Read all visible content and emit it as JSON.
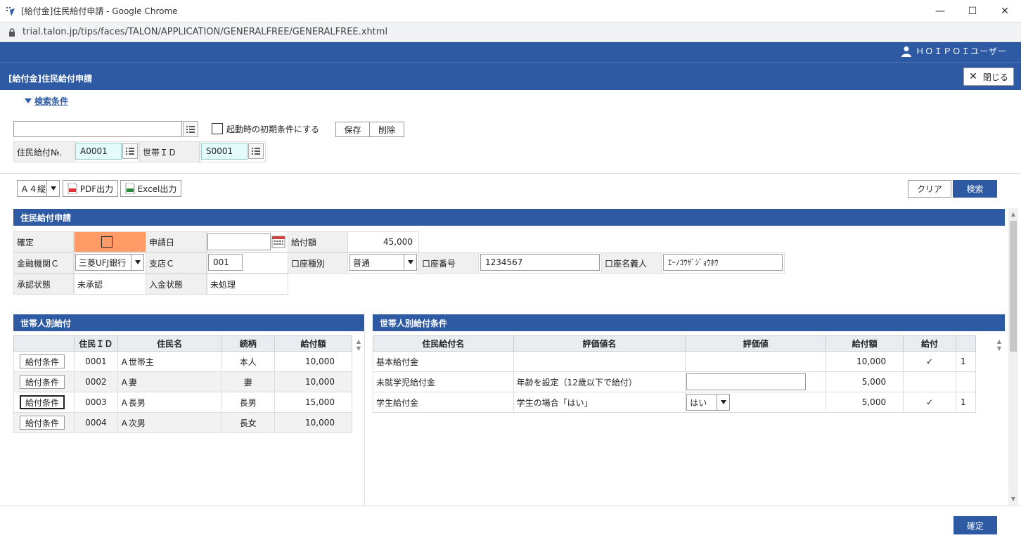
{
  "window": {
    "title": "[給付金]住民給付申請 - Google Chrome",
    "url": "trial.talon.jp/tips/faces/TALON/APPLICATION/GENERALFREE/GENERALFREE.xhtml"
  },
  "header": {
    "user_name": "ＨＯＩＰＯＩユーザー",
    "page_title": "[給付金]住民給付申請",
    "close_label": "閉じる"
  },
  "search": {
    "toggle_label": "検索条件",
    "preset_value": "",
    "startup_checkbox_label": "起動時の初期条件にする",
    "save_label": "保存",
    "delete_label": "削除",
    "fields": [
      {
        "label": "住民給付№.",
        "value": "A0001"
      },
      {
        "label": "世帯ＩＤ",
        "value": "S0001"
      }
    ]
  },
  "toolbar": {
    "paper_size": "Ａ４縦",
    "pdf_label": "PDF出力",
    "excel_label": "Excel出力",
    "clear_label": "クリア",
    "search_label": "検索"
  },
  "application": {
    "section_title": "住民給付申請",
    "kakutei_label": "確定",
    "shinsei_date_label": "申請日",
    "shinsei_date_value": "",
    "kyufu_amount_label": "給付額",
    "kyufu_amount_value": "45,000",
    "bank_label": "金融機関Ｃ",
    "bank_value": "三菱UFJ銀行",
    "branch_label": "支店Ｃ",
    "branch_value": "001",
    "account_type_label": "口座種別",
    "account_type_value": "普通",
    "account_no_label": "口座番号",
    "account_no_value": "1234567",
    "account_name_label": "口座名義人",
    "account_name_value": "ｴｰﾉｺｳｻﾞｼﾞｮｳﾎｳ",
    "approval_label": "承認状態",
    "approval_value": "未承認",
    "deposit_label": "入金状態",
    "deposit_value": "未処理"
  },
  "household": {
    "section_title": "世帯人別給付",
    "columns": [
      "住民ＩＤ",
      "住民名",
      "続柄",
      "給付額"
    ],
    "row_button_label": "給付条件",
    "rows": [
      {
        "id": "0001",
        "name": "Ａ世帯主",
        "relation": "本人",
        "amount": "10,000"
      },
      {
        "id": "0002",
        "name": "Ａ妻",
        "relation": "妻",
        "amount": "10,000"
      },
      {
        "id": "0003",
        "name": "Ａ長男",
        "relation": "長男",
        "amount": "15,000"
      },
      {
        "id": "0004",
        "name": "Ａ次男",
        "relation": "長女",
        "amount": "10,000"
      }
    ]
  },
  "conditions": {
    "section_title": "世帯人別給付条件",
    "columns": [
      "住民給付名",
      "評価値名",
      "評価値",
      "給付額",
      "給付",
      ""
    ],
    "rows": [
      {
        "name": "基本給付金",
        "eval_name": "",
        "eval_value": "",
        "amount": "10,000",
        "check": "✓",
        "count": "1"
      },
      {
        "name": "未就学児給付金",
        "eval_name": "年齢を設定（12歳以下で給付）",
        "eval_value": "",
        "amount": "5,000",
        "check": "",
        "count": ""
      },
      {
        "name": "学生給付金",
        "eval_name": "学生の場合「はい」",
        "eval_value": "はい",
        "amount": "5,000",
        "check": "✓",
        "count": "1"
      }
    ]
  },
  "footer": {
    "confirm_label": "確定"
  }
}
